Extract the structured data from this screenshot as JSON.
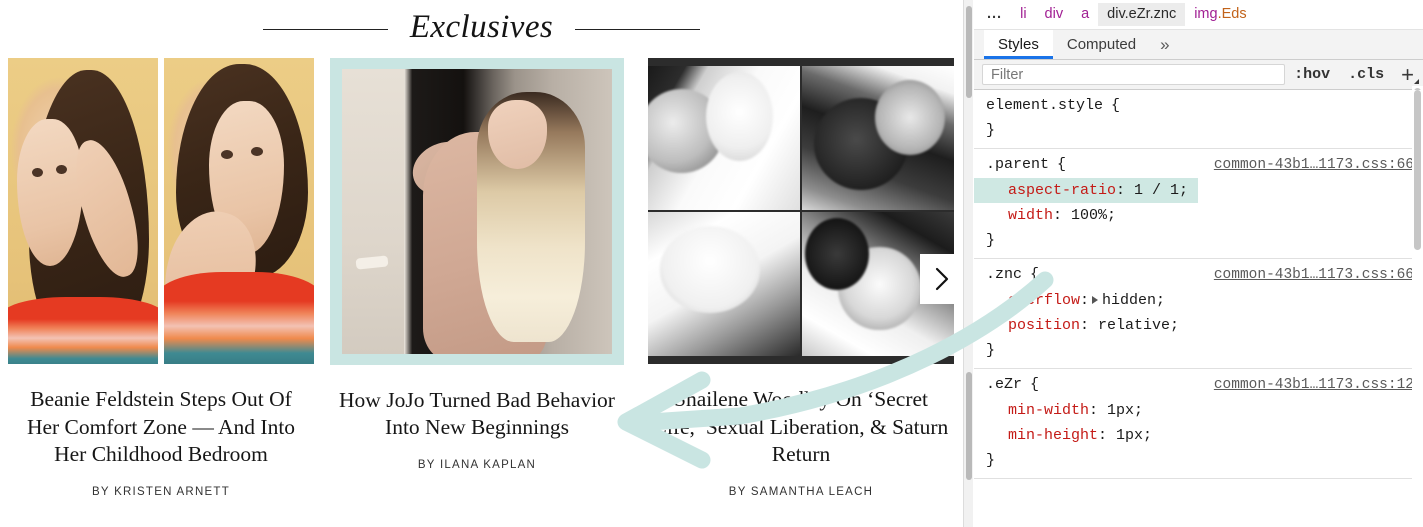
{
  "page": {
    "section_title": "Exclusives",
    "next_button_icon": "chevron-right-icon",
    "cards": [
      {
        "title": "Beanie Feldstein Steps Out Of Her Comfort Zone — And Into Her Childhood Bedroom",
        "byline": "BY KRISTEN ARNETT",
        "image_alt": "diptych-portrait-yellow-background"
      },
      {
        "title": "How JoJo Turned Bad Behavior Into New Beginnings",
        "byline": "BY ILANA KAPLAN",
        "image_alt": "blonde-woman-beige-outfit-doorway"
      },
      {
        "title": "Shailene Woodley On ‘Secret Life,’ Sexual Liberation, & Saturn Return",
        "byline": "BY SAMANTHA LEACH",
        "image_alt": "black-and-white-four-panel-collage"
      }
    ]
  },
  "devtools": {
    "breadcrumbs": [
      {
        "label": "...",
        "kind": "dots"
      },
      {
        "label": "li",
        "kind": "tag"
      },
      {
        "label": "div",
        "kind": "tag"
      },
      {
        "label": "a",
        "kind": "tag"
      },
      {
        "label": "div.eZr.znc",
        "kind": "selected"
      },
      {
        "label": "img.Eds",
        "kind": "tag-class",
        "tag": "img",
        "cls": ".Eds"
      }
    ],
    "tabs": [
      {
        "label": "Styles",
        "active": true
      },
      {
        "label": "Computed",
        "active": false
      },
      {
        "label": "»",
        "active": false
      }
    ],
    "filter": {
      "placeholder": "Filter",
      "value": "",
      "hov_label": ":hov",
      "cls_label": ".cls",
      "new_rule_label": "+"
    },
    "rules": [
      {
        "selector": "element.style",
        "open_brace": "{",
        "source": "",
        "declarations": [],
        "close_brace": "}"
      },
      {
        "selector": ".parent",
        "open_brace": "{",
        "source": "common-43b1…1173.css:66",
        "declarations": [
          {
            "prop": "aspect-ratio",
            "value": "1 / 1;",
            "highlighted": true,
            "expandable": false
          },
          {
            "prop": "width",
            "value": "100%;",
            "highlighted": false,
            "expandable": false
          }
        ],
        "close_brace": "}"
      },
      {
        "selector": ".znc",
        "open_brace": "{",
        "source": "common-43b1…1173.css:66",
        "declarations": [
          {
            "prop": "overflow",
            "value": "hidden;",
            "highlighted": false,
            "expandable": true
          },
          {
            "prop": "position",
            "value": "relative;",
            "highlighted": false,
            "expandable": false
          }
        ],
        "close_brace": "}"
      },
      {
        "selector": ".eZr",
        "open_brace": "{",
        "source": "common-43b1…1173.css:12",
        "declarations": [
          {
            "prop": "min-width",
            "value": "1px;",
            "highlighted": false,
            "expandable": false
          },
          {
            "prop": "min-height",
            "value": "1px;",
            "highlighted": false,
            "expandable": false
          }
        ],
        "close_brace": "}"
      }
    ]
  },
  "annotation": {
    "type": "curved-arrow",
    "direction": "points-left",
    "color": "#c9e5e2"
  },
  "colors": {
    "highlight_teal": "#c9e5e2",
    "declaration_highlight": "#cfe8e3",
    "prop_red": "#c41a16",
    "tag_purple": "#a11f93",
    "class_orange": "#c2631a",
    "tab_underline_blue": "#1a73e8"
  }
}
